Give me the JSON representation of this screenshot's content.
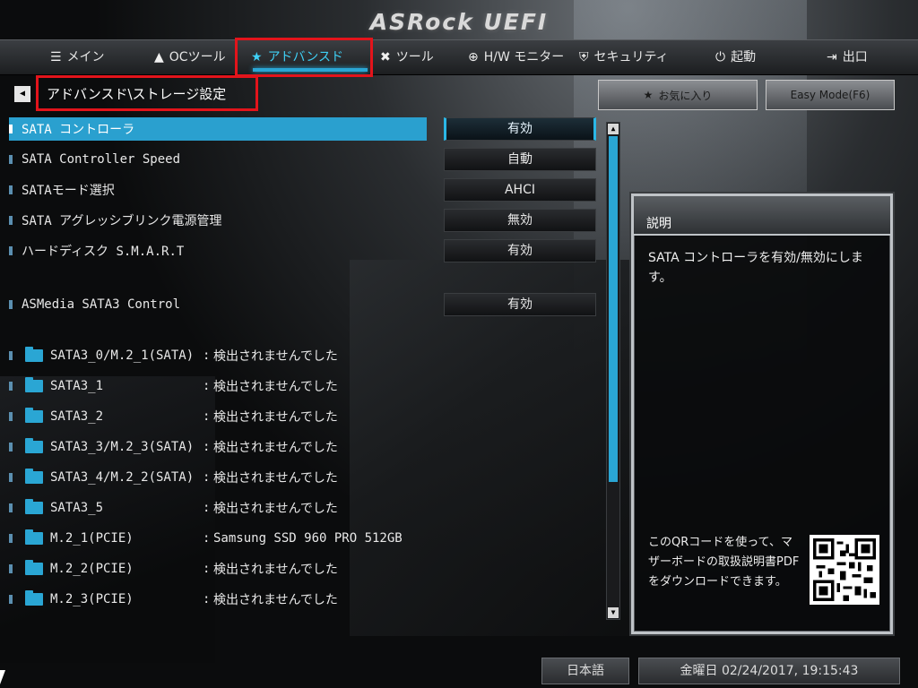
{
  "header": {
    "logo": "ASRock UEFI"
  },
  "tabs": [
    {
      "icon": "☰",
      "label": "メイン"
    },
    {
      "icon": "▲",
      "label": "OCツール"
    },
    {
      "icon": "★",
      "label": "アドバンスド"
    },
    {
      "icon": "✖",
      "label": "ツール"
    },
    {
      "icon": "⊕",
      "label": "H/W モニター"
    },
    {
      "icon": "⛨",
      "label": "セキュリティ"
    },
    {
      "icon": "⏻",
      "label": "起動"
    },
    {
      "icon": "⇥",
      "label": "出口"
    }
  ],
  "breadcrumb": "アドバンスド\\ストレージ設定",
  "buttons": {
    "favorite": "お気に入り",
    "easy_mode": "Easy Mode(F6)"
  },
  "settings": [
    {
      "label": "SATA コントローラ",
      "value": "有効"
    },
    {
      "label": "SATA Controller Speed",
      "value": "自動"
    },
    {
      "label": "SATAモード選択",
      "value": "AHCI"
    },
    {
      "label": "SATA アグレッシブリンク電源管理",
      "value": "無効"
    },
    {
      "label": "ハードディスク S.M.A.R.T",
      "value": "有効"
    },
    {
      "label": "ASMedia SATA3 Control",
      "value": "有効"
    }
  ],
  "disks": [
    {
      "name": "SATA3_0/M.2_1(SATA)",
      "status": "検出されませんでした"
    },
    {
      "name": "SATA3_1",
      "status": "検出されませんでした"
    },
    {
      "name": "SATA3_2",
      "status": "検出されませんでした"
    },
    {
      "name": "SATA3_3/M.2_3(SATA)",
      "status": "検出されませんでした"
    },
    {
      "name": "SATA3_4/M.2_2(SATA)",
      "status": "検出されませんでした"
    },
    {
      "name": "SATA3_5",
      "status": "検出されませんでした"
    },
    {
      "name": "M.2_1(PCIE)",
      "status": "Samsung SSD 960  PRO 512GB"
    },
    {
      "name": "M.2_2(PCIE)",
      "status": "検出されませんでした"
    },
    {
      "name": "M.2_3(PCIE)",
      "status": "検出されませんでした"
    }
  ],
  "help": {
    "title": "説明",
    "text": "SATA コントローラを有効/無効にします。",
    "qr_text": "このQRコードを使って、マザーボードの取扱説明書PDFをダウンロードできます。"
  },
  "footer": {
    "language": "日本語",
    "datetime": "金曜日 02/24/2017, 19:15:43"
  },
  "colors": {
    "accent": "#2aa6d4",
    "highlight_box": "#e3141b"
  }
}
